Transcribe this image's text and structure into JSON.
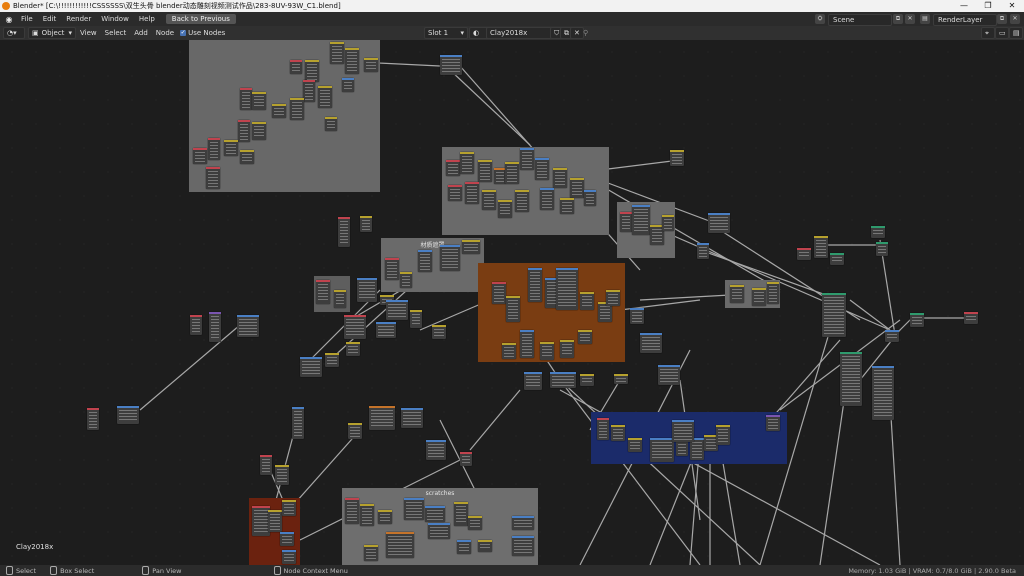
{
  "titlebar": {
    "title": "Blender* [C:\\!!!!!!!!!!!!CSSSSSS\\双生头骨  blender动态雕刻视频测试作品\\283-8UV-93W_C1.blend]",
    "minimize": "—",
    "maximize": "❐",
    "close": "✕"
  },
  "menubar": {
    "items": [
      "File",
      "Edit",
      "Render",
      "Window",
      "Help"
    ],
    "back_button": "Back to Previous",
    "scene": "Scene",
    "render_layer": "RenderLayer"
  },
  "toolbar": {
    "object_mode": "Object",
    "menus": [
      "View",
      "Select",
      "Add",
      "Node"
    ],
    "use_nodes_label": "Use Nodes",
    "slot": "Slot 1",
    "material": "Clay2018x"
  },
  "frames": {
    "orange_label": "",
    "gray_label": "材质遮罩",
    "scratches_label": "scratches"
  },
  "canvas_label": "Clay2018x",
  "statusbar": {
    "select": "Select",
    "box_select": "Box Select",
    "pan_view": "Pan View",
    "context_menu": "Node Context Menu",
    "stats": "Memory: 1.03 GiB | VRAM: 0.7/8.0 GiB | 2.90.0 Beta"
  },
  "colors": {
    "frame_gray": "#6e6e6e",
    "frame_orange": "#7a3d12",
    "frame_blue": "#1b2b6a",
    "frame_red": "#6b220f",
    "node_header_red": "#c0434e",
    "node_header_blue": "#4a7fc4",
    "node_header_yellow": "#b6a12e",
    "node_header_green": "#2f9a6d",
    "node_header_purple": "#7a55b0",
    "node_header_orange": "#c4732a"
  }
}
